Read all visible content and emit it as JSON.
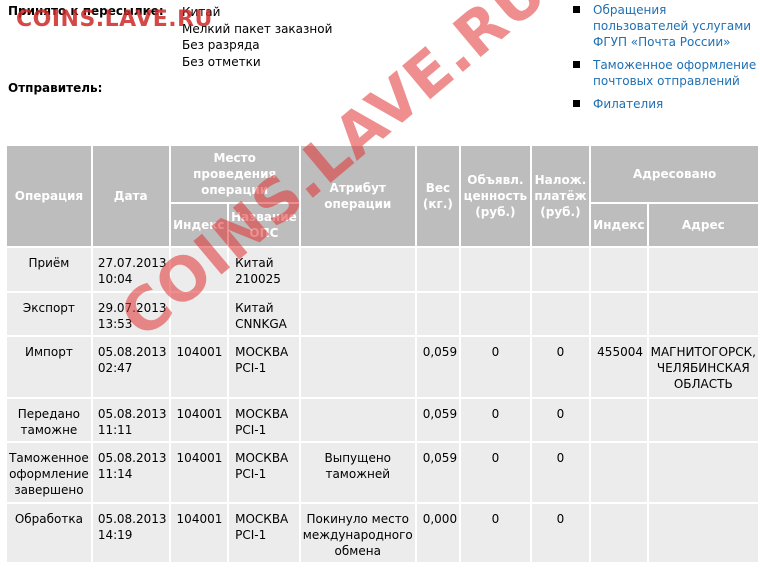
{
  "header": {
    "accepted_label": "Принято к пересылке:",
    "accepted_lines": [
      "Китай",
      "Мелкий пакет заказной",
      "Без разряда",
      "Без отметки"
    ],
    "sender_label": "Отправитель:"
  },
  "side_links": [
    "Обращения пользователей услугами ФГУП «Почта России»",
    "Таможенное оформление почтовых отправлений",
    "Филателия"
  ],
  "table": {
    "headers": {
      "operation": "Операция",
      "date": "Дата",
      "place": "Место проведения операции",
      "index": "Индекс",
      "ops_name": "Название ОПС",
      "attribute": "Атрибут операции",
      "weight": "Вес (кг.)",
      "declared": "Объявл. ценность (руб.)",
      "cod": "Налож. платёж (руб.)",
      "addressed": "Адресовано",
      "addr_index": "Индекс",
      "addr_address": "Адрес"
    },
    "rows": [
      {
        "operation": "Приём",
        "date": "27.07.2013 10:04",
        "index": "",
        "ops": "Китай 210025",
        "attribute": "",
        "weight": "",
        "declared": "",
        "cod": "",
        "addr_index": "",
        "address": ""
      },
      {
        "operation": "Экспорт",
        "date": "29.07.2013 13:53",
        "index": "",
        "ops": "Китай CNNKGA",
        "attribute": "",
        "weight": "",
        "declared": "",
        "cod": "",
        "addr_index": "",
        "address": ""
      },
      {
        "operation": "Импорт",
        "date": "05.08.2013 02:47",
        "index": "104001",
        "ops": "МОСКВА PCI-1",
        "attribute": "",
        "weight": "0,059",
        "declared": "0",
        "cod": "0",
        "addr_index": "455004",
        "address": "МАГНИТОГОРСК, ЧЕЛЯБИНСКАЯ ОБЛАСТЬ"
      },
      {
        "operation": "Передано таможне",
        "date": "05.08.2013 11:11",
        "index": "104001",
        "ops": "МОСКВА PCI-1",
        "attribute": "",
        "weight": "0,059",
        "declared": "0",
        "cod": "0",
        "addr_index": "",
        "address": ""
      },
      {
        "operation": "Таможенное оформление завершено",
        "date": "05.08.2013 11:14",
        "index": "104001",
        "ops": "МОСКВА PCI-1",
        "attribute": "Выпущено таможней",
        "weight": "0,059",
        "declared": "0",
        "cod": "0",
        "addr_index": "",
        "address": ""
      },
      {
        "operation": "Обработка",
        "date": "05.08.2013 14:19",
        "index": "104001",
        "ops": "МОСКВА PCI-1",
        "attribute": "Покинуло место международного обмена",
        "weight": "0,000",
        "declared": "0",
        "cod": "0",
        "addr_index": "",
        "address": ""
      }
    ]
  },
  "watermarks": {
    "top": "COINS.LAVE.RU",
    "diagonal": "COINS.LAVE.RU"
  }
}
